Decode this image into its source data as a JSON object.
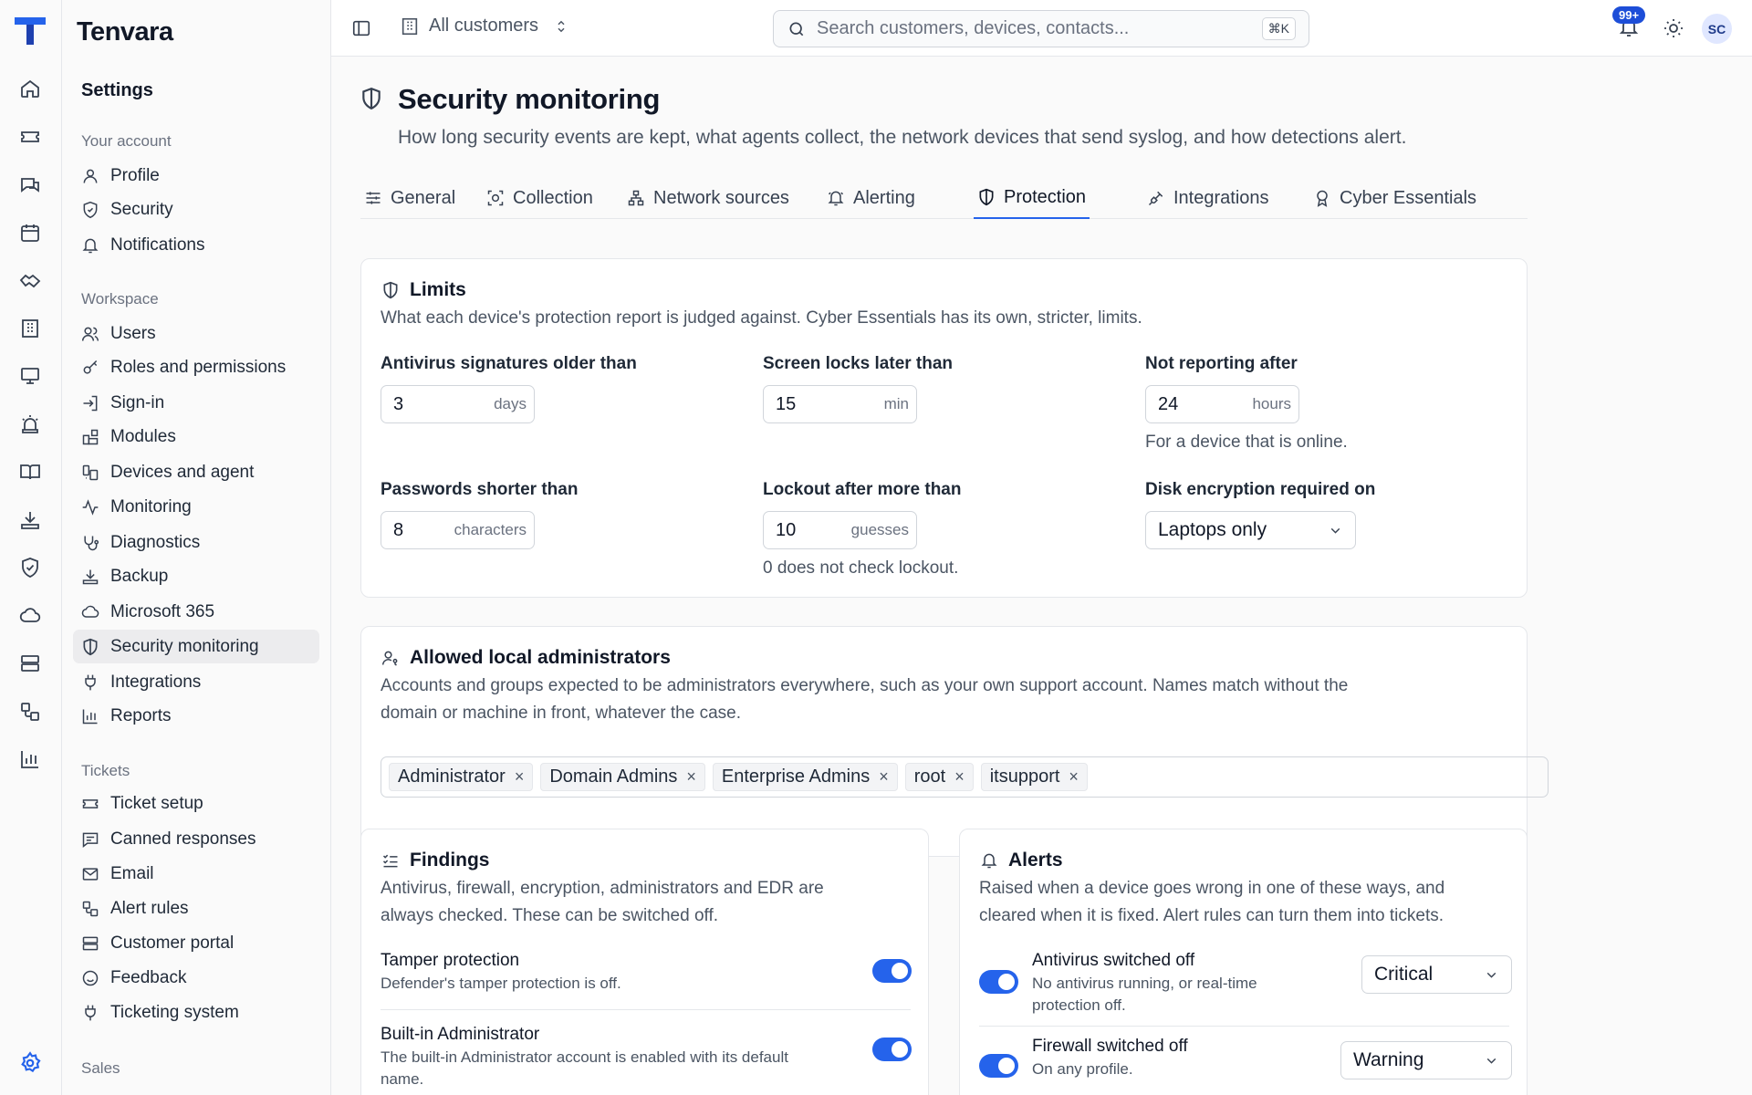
{
  "app": {
    "name": "Tenvara"
  },
  "rail": {
    "icons": [
      "home-icon",
      "ticket-icon",
      "chat-icon",
      "calendar-icon",
      "handshake-icon",
      "building-icon",
      "monitor-icon",
      "siren-icon",
      "book-icon",
      "download-tray-icon",
      "shield-check-icon",
      "cloud-icon",
      "server-icon",
      "workflow-icon",
      "bar-chart-icon",
      "settings-icon"
    ]
  },
  "sidebar": {
    "title": "Settings",
    "your_account": {
      "label": "Your account",
      "items": [
        {
          "label": "Profile",
          "icon": "user-icon"
        },
        {
          "label": "Security",
          "icon": "shield-icon"
        },
        {
          "label": "Notifications",
          "icon": "bell-icon"
        }
      ]
    },
    "workspace": {
      "label": "Workspace",
      "items": [
        {
          "label": "Users",
          "icon": "users-icon"
        },
        {
          "label": "Roles and permissions",
          "icon": "key-icon"
        },
        {
          "label": "Sign-in",
          "icon": "login-icon"
        },
        {
          "label": "Modules",
          "icon": "blocks-icon"
        },
        {
          "label": "Devices and agent",
          "icon": "devices-icon"
        },
        {
          "label": "Monitoring",
          "icon": "activity-icon"
        },
        {
          "label": "Diagnostics",
          "icon": "stethoscope-icon"
        },
        {
          "label": "Backup",
          "icon": "backup-icon"
        },
        {
          "label": "Microsoft 365",
          "icon": "cloud-icon"
        },
        {
          "label": "Security monitoring",
          "icon": "shield-half-icon",
          "active": true
        },
        {
          "label": "Integrations",
          "icon": "plug-icon"
        },
        {
          "label": "Reports",
          "icon": "chart-icon"
        }
      ]
    },
    "tickets": {
      "label": "Tickets",
      "items": [
        {
          "label": "Ticket setup",
          "icon": "ticket-icon"
        },
        {
          "label": "Canned responses",
          "icon": "message-icon"
        },
        {
          "label": "Email",
          "icon": "mail-icon"
        },
        {
          "label": "Alert rules",
          "icon": "workflow-icon"
        },
        {
          "label": "Customer portal",
          "icon": "layout-icon"
        },
        {
          "label": "Feedback",
          "icon": "smile-icon"
        },
        {
          "label": "Ticketing system",
          "icon": "plug-icon"
        }
      ]
    },
    "sales": {
      "label": "Sales"
    }
  },
  "topbar": {
    "customer_scope": "All customers",
    "search_placeholder": "Search customers, devices, contacts...",
    "search_shortcut": "⌘K",
    "notification_count": "99+",
    "avatar_initials": "SC"
  },
  "page": {
    "title": "Security monitoring",
    "subtitle": "How long security events are kept, what agents collect, the network devices that send syslog, and how detections alert.",
    "tabs": [
      {
        "label": "General",
        "icon": "sliders-icon"
      },
      {
        "label": "Collection",
        "icon": "scan-icon"
      },
      {
        "label": "Network sources",
        "icon": "network-icon"
      },
      {
        "label": "Alerting",
        "icon": "bell-ring-icon"
      },
      {
        "label": "Protection",
        "icon": "shield-half-icon",
        "active": true
      },
      {
        "label": "Integrations",
        "icon": "plug-icon"
      },
      {
        "label": "Cyber Essentials",
        "icon": "award-icon"
      }
    ]
  },
  "limits": {
    "title": "Limits",
    "description": "What each device's protection report is judged against. Cyber Essentials has its own, stricter, limits.",
    "av_label": "Antivirus signatures older than",
    "av_value": "3",
    "av_unit": "days",
    "screen_label": "Screen locks later than",
    "screen_value": "15",
    "screen_unit": "min",
    "report_label": "Not reporting after",
    "report_value": "24",
    "report_unit": "hours",
    "report_hint": "For a device that is online.",
    "pw_label": "Passwords shorter than",
    "pw_value": "8",
    "pw_unit": "characters",
    "lockout_label": "Lockout after more than",
    "lockout_value": "10",
    "lockout_unit": "guesses",
    "lockout_hint": "0 does not check lockout.",
    "disk_label": "Disk encryption required on",
    "disk_value": "Laptops only"
  },
  "admins": {
    "title": "Allowed local administrators",
    "description_1": "Accounts and groups expected to be administrators everywhere, such as your own support account. Names match without the",
    "description_2": "domain or machine in front, whatever the case.",
    "chips": [
      "Administrator",
      "Domain Admins",
      "Enterprise Admins",
      "root",
      "itsupport"
    ],
    "chip_remove": "×"
  },
  "findings": {
    "title": "Findings",
    "description_1": "Antivirus, firewall, encryption, administrators and EDR are",
    "description_2": "always checked. These can be switched off.",
    "rows": [
      {
        "title": "Tamper protection",
        "sub": "Defender's tamper protection is off.",
        "on": true
      },
      {
        "title": "Built-in Administrator",
        "sub_1": "The built-in Administrator account is enabled with its default",
        "sub_2": "name.",
        "on": true
      }
    ]
  },
  "alerts": {
    "title": "Alerts",
    "description_1": "Raised when a device goes wrong in one of these ways, and",
    "description_2": "cleared when it is fixed. Alert rules can turn them into tickets.",
    "rows": [
      {
        "title": "Antivirus switched off",
        "sub_1": "No antivirus running, or real-time",
        "sub_2": "protection off.",
        "severity": "Critical",
        "on": true
      },
      {
        "title": "Firewall switched off",
        "sub_1": "On any profile.",
        "severity": "Warning",
        "on": true
      }
    ]
  },
  "colors": {
    "accent": "#2563eb",
    "badge": "#1d4ed8",
    "active_nav": "#ececee"
  }
}
